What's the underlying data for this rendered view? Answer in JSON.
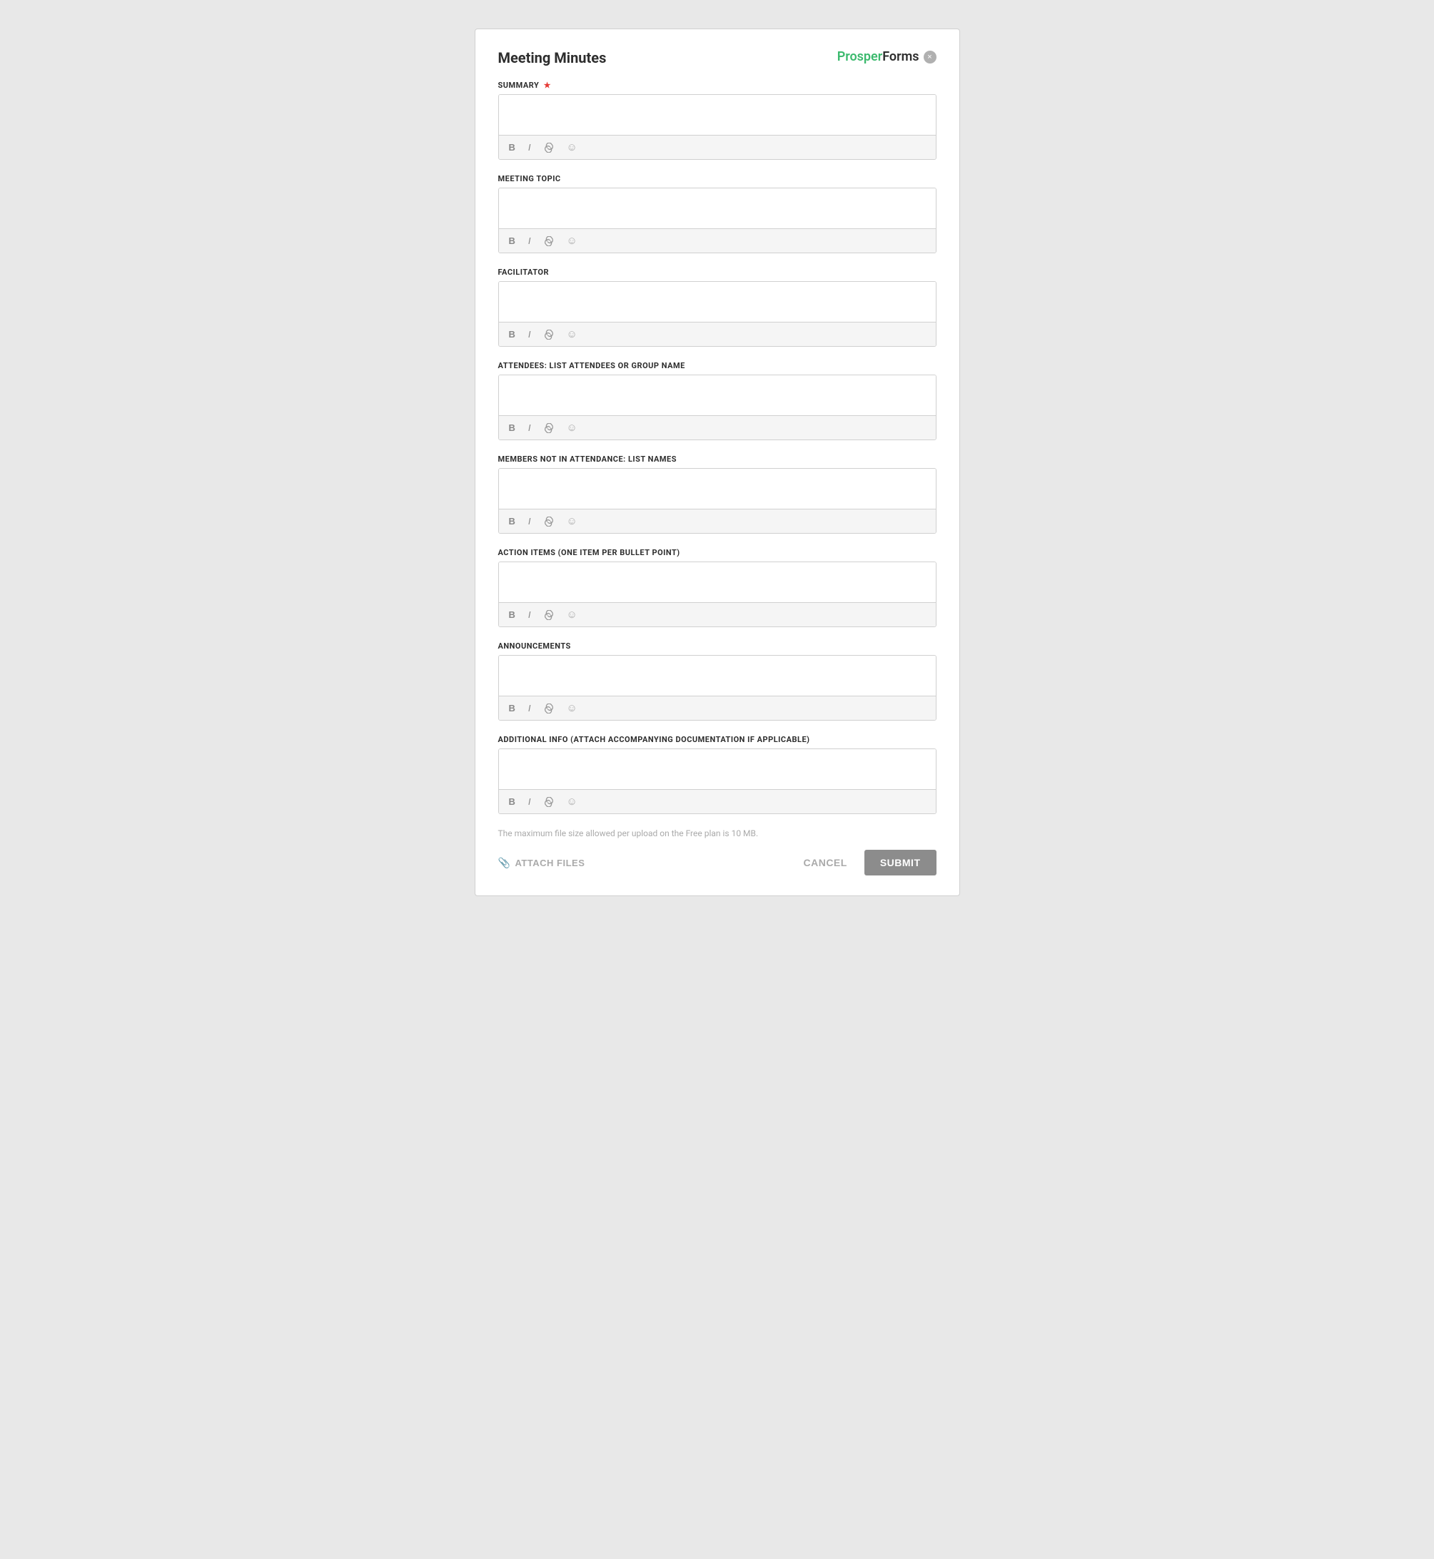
{
  "header": {
    "title": "Meeting Minutes",
    "logo_prosper": "Prosper",
    "logo_forms": "Forms",
    "close_label": "×"
  },
  "fields": [
    {
      "id": "summary",
      "label": "SUMMARY",
      "required": true,
      "toolbar": [
        "B",
        "I",
        "🔗",
        "🙂"
      ]
    },
    {
      "id": "meeting_topic",
      "label": "MEETING TOPIC",
      "required": false,
      "toolbar": [
        "B",
        "I",
        "🔗",
        "🙂"
      ]
    },
    {
      "id": "facilitator",
      "label": "FACILITATOR",
      "required": false,
      "toolbar": [
        "B",
        "I",
        "🔗",
        "🙂"
      ]
    },
    {
      "id": "attendees",
      "label": "ATTENDEES: LIST ATTENDEES OR GROUP NAME",
      "required": false,
      "toolbar": [
        "B",
        "I",
        "🔗",
        "🙂"
      ]
    },
    {
      "id": "members_not_attending",
      "label": "MEMBERS NOT IN ATTENDANCE: LIST NAMES",
      "required": false,
      "toolbar": [
        "B",
        "I",
        "🔗",
        "🙂"
      ]
    },
    {
      "id": "action_items",
      "label": "ACTION ITEMS (ONE ITEM PER BULLET POINT)",
      "required": false,
      "toolbar": [
        "B",
        "I",
        "🔗",
        "🙂"
      ]
    },
    {
      "id": "announcements",
      "label": "ANNOUNCEMENTS",
      "required": false,
      "toolbar": [
        "B",
        "I",
        "🔗",
        "🙂"
      ]
    },
    {
      "id": "additional_info",
      "label": "ADDITIONAL INFO (ATTACH ACCOMPANYING DOCUMENTATION IF APPLICABLE)",
      "required": false,
      "toolbar": [
        "B",
        "I",
        "🔗",
        "🙂"
      ]
    }
  ],
  "footer": {
    "file_size_note": "The maximum file size allowed per upload on the Free plan is 10 MB.",
    "attach_label": "ATTACH FILES",
    "cancel_label": "CANCEL",
    "submit_label": "SUBMIT"
  }
}
